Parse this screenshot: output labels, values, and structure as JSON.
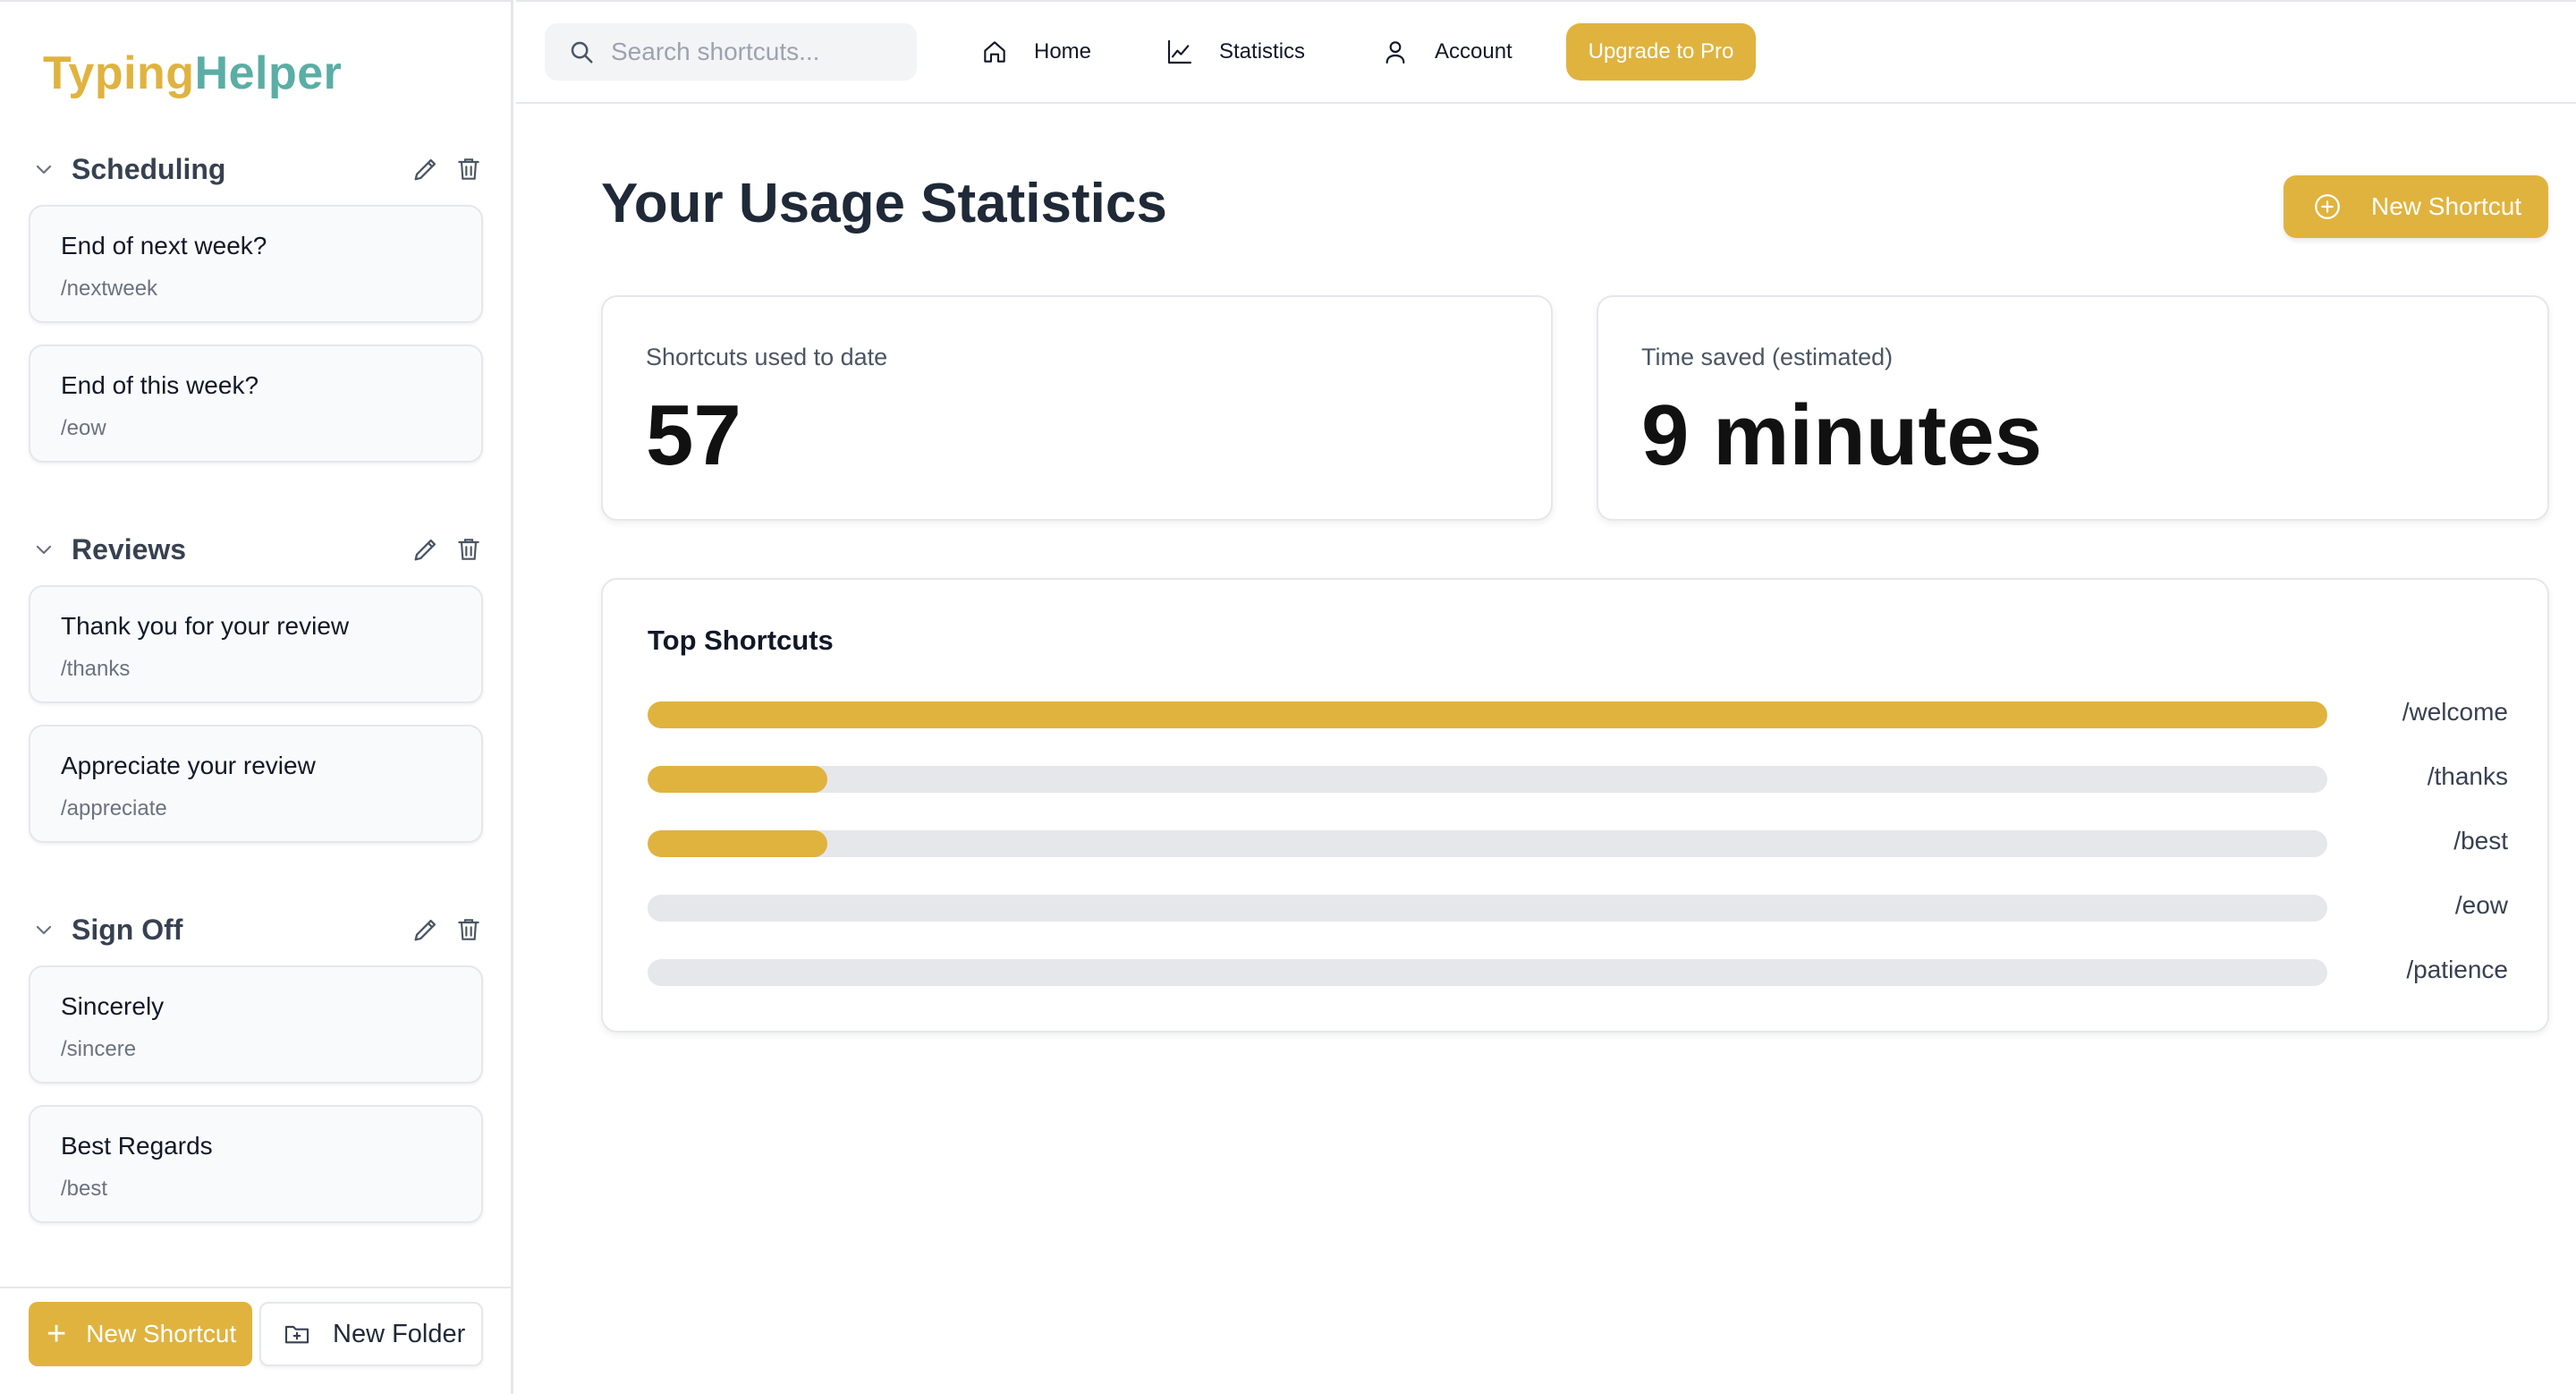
{
  "app": {
    "logo_part1": "Typing",
    "logo_part2": "Helper",
    "accent_color": "#e0b33f",
    "logo_second_color": "#5aaea5"
  },
  "sidebar": {
    "folders": [
      {
        "name": "Scheduling",
        "shortcuts": [
          {
            "title": "End of next week?",
            "command": "/nextweek"
          },
          {
            "title": "End of this week?",
            "command": "/eow"
          }
        ]
      },
      {
        "name": "Reviews",
        "shortcuts": [
          {
            "title": "Thank you for your review",
            "command": "/thanks"
          },
          {
            "title": "Appreciate your review",
            "command": "/appreciate"
          }
        ]
      },
      {
        "name": "Sign Off",
        "shortcuts": [
          {
            "title": "Sincerely",
            "command": "/sincere"
          },
          {
            "title": "Best Regards",
            "command": "/best"
          }
        ]
      }
    ],
    "new_shortcut_label": "New Shortcut",
    "new_folder_label": "New Folder"
  },
  "topbar": {
    "search_placeholder": "Search shortcuts...",
    "nav": {
      "home": "Home",
      "statistics": "Statistics",
      "account": "Account"
    },
    "upgrade_label": "Upgrade to Pro"
  },
  "main": {
    "title": "Your Usage Statistics",
    "new_shortcut_label": "New Shortcut",
    "stats": {
      "used_label": "Shortcuts used to date",
      "used_value": "57",
      "saved_label": "Time saved (estimated)",
      "saved_value": "9 minutes"
    },
    "top_shortcuts": {
      "title": "Top Shortcuts",
      "items": [
        {
          "command": "/welcome",
          "fraction": 1.0
        },
        {
          "command": "/thanks",
          "fraction": 0.107
        },
        {
          "command": "/best",
          "fraction": 0.107
        },
        {
          "command": "/eow",
          "fraction": 0.0
        },
        {
          "command": "/patience",
          "fraction": 0.0
        }
      ]
    }
  }
}
